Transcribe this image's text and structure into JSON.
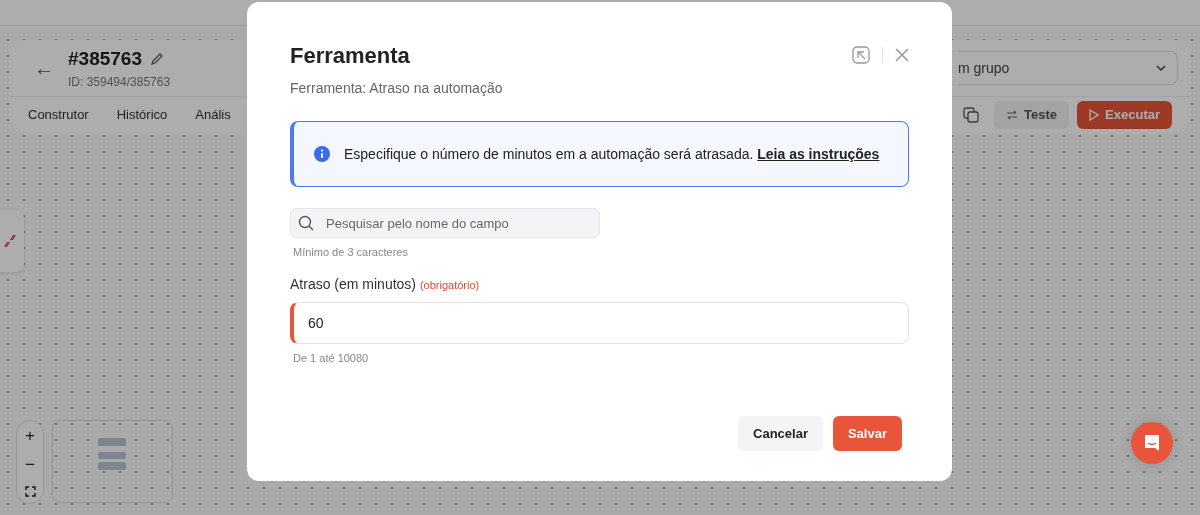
{
  "header": {
    "back": "←",
    "title": "#385763",
    "id_text": "ID: 359494/385763",
    "tabs": [
      {
        "label": "Construtor"
      },
      {
        "label": "Histórico"
      },
      {
        "label": "Anális"
      }
    ],
    "group_select": "m grupo",
    "test_button": "Teste",
    "run_button": "Executar"
  },
  "zoom_controls": [
    "+",
    "−"
  ],
  "modal": {
    "title": "Ferramenta",
    "subtitle": "Ferramenta: Atraso na automação",
    "alert": {
      "text": "Especifique o número de minutos em a automação será atrasada.",
      "link": "Leia as instruções"
    },
    "search": {
      "placeholder": "Pesquisar pelo nome do campo",
      "hint": "Mínimo de 3 caracteres"
    },
    "field": {
      "label": "Atraso (em minutos)",
      "required_tag": "(obrigatório)",
      "value": "60",
      "highlighted": true,
      "hint": "De 1 até 10080"
    },
    "buttons": [
      {
        "label": "Cancelar",
        "kind": "secondary"
      },
      {
        "label": "Salvar",
        "kind": "primary"
      }
    ]
  }
}
